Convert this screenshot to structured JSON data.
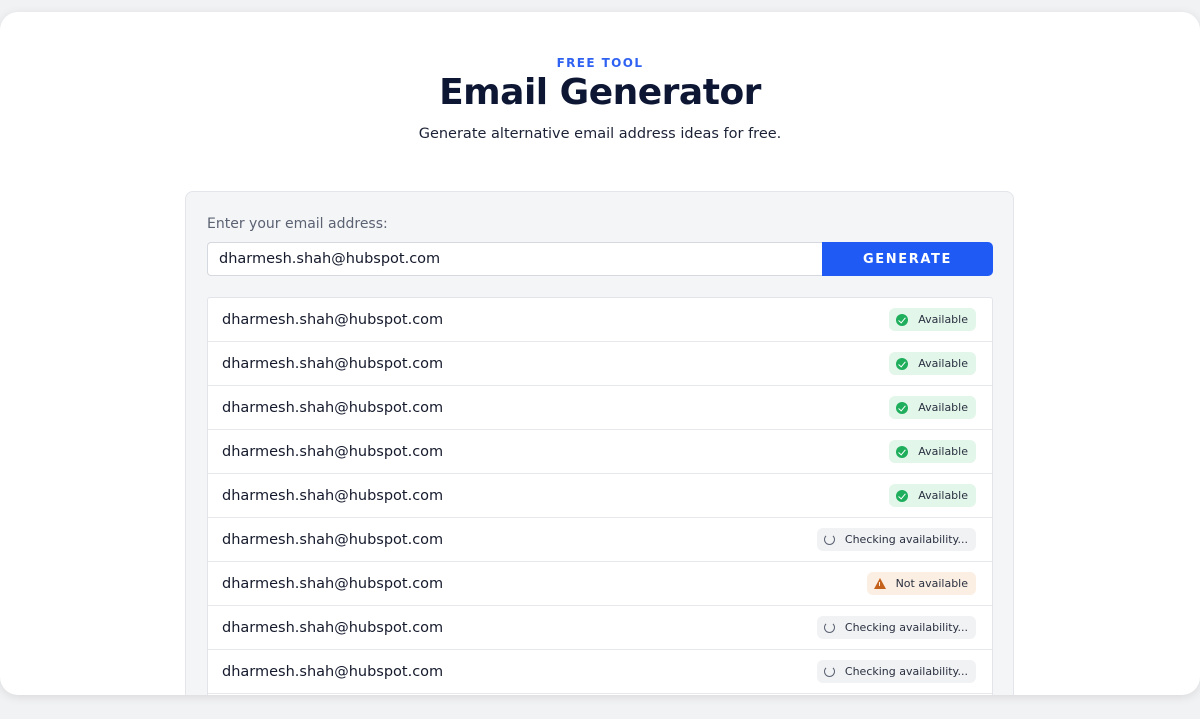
{
  "header": {
    "eyebrow": "FREE TOOL",
    "title": "Email Generator",
    "subtitle": "Generate alternative email address ideas for free."
  },
  "form": {
    "label": "Enter your email address:",
    "email_value": "dharmesh.shah@hubspot.com",
    "generate_label": "GENERATE"
  },
  "colors": {
    "accent": "#1f5af5",
    "available": "#1fae5c",
    "not_available": "#c4621c"
  },
  "results": [
    {
      "email": "dharmesh.shah@hubspot.com",
      "status": "available",
      "status_label": "Available",
      "icon": "check-icon"
    },
    {
      "email": "dharmesh.shah@hubspot.com",
      "status": "available",
      "status_label": "Available",
      "icon": "check-icon"
    },
    {
      "email": "dharmesh.shah@hubspot.com",
      "status": "available",
      "status_label": "Available",
      "icon": "check-icon"
    },
    {
      "email": "dharmesh.shah@hubspot.com",
      "status": "available",
      "status_label": "Available",
      "icon": "check-icon"
    },
    {
      "email": "dharmesh.shah@hubspot.com",
      "status": "available",
      "status_label": "Available",
      "icon": "check-icon"
    },
    {
      "email": "dharmesh.shah@hubspot.com",
      "status": "checking",
      "status_label": "Checking availability...",
      "icon": "spinner-icon"
    },
    {
      "email": "dharmesh.shah@hubspot.com",
      "status": "unavailable",
      "status_label": "Not available",
      "icon": "warning-icon"
    },
    {
      "email": "dharmesh.shah@hubspot.com",
      "status": "checking",
      "status_label": "Checking availability...",
      "icon": "spinner-icon"
    },
    {
      "email": "dharmesh.shah@hubspot.com",
      "status": "checking",
      "status_label": "Checking availability...",
      "icon": "spinner-icon"
    }
  ]
}
